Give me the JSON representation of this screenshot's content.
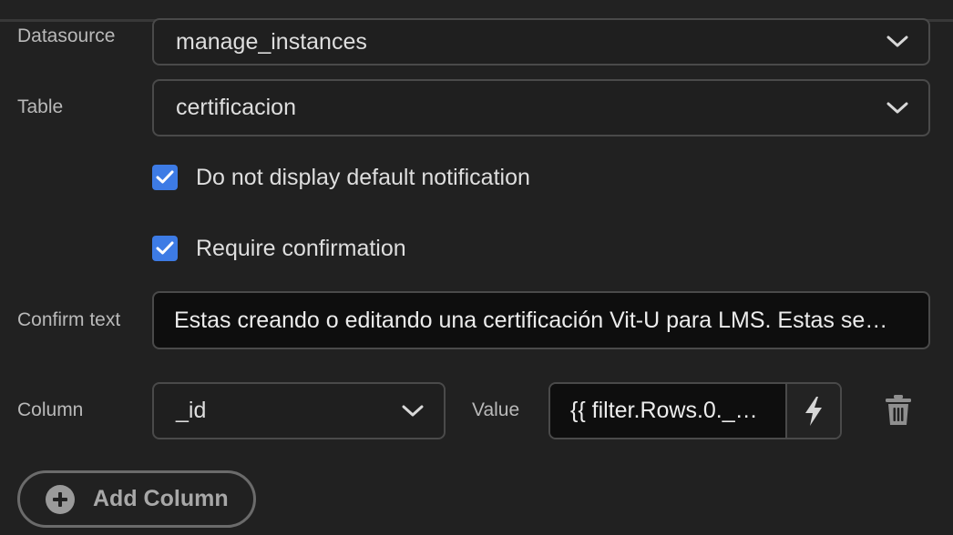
{
  "datasource": {
    "label": "Datasource",
    "value": "manage_instances",
    "icon": "chevron-down-icon"
  },
  "table": {
    "label": "Table",
    "value": "certificacion",
    "icon": "chevron-down-icon"
  },
  "options": {
    "no_notification": {
      "label": "Do not display default notification",
      "checked": true
    },
    "require_confirmation": {
      "label": "Require confirmation",
      "checked": true
    }
  },
  "confirm": {
    "label": "Confirm text",
    "value": "Estas creando o editando una certificación Vit-U para LMS. Estas se…"
  },
  "column_row": {
    "column_label": "Column",
    "column_value": "_id",
    "value_label": "Value",
    "value_text": "{{ filter.Rows.0._…",
    "value_icon": "lightning-bolt-icon",
    "delete_icon": "trash-icon"
  },
  "add_column": {
    "label": "Add Column",
    "icon": "plus-circle-icon"
  },
  "colors": {
    "background": "#212121",
    "checkbox_accent": "#3d7be5",
    "border": "#4a4a4a"
  }
}
